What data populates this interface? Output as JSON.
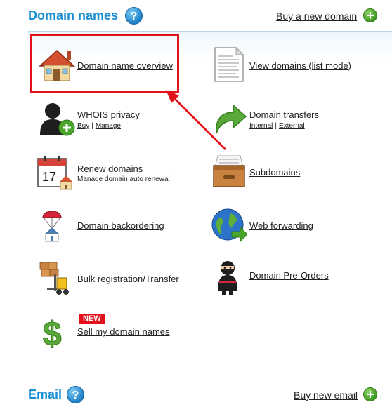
{
  "domains_section": {
    "title": "Domain names",
    "help": "?",
    "buy_link": "Buy a new domain"
  },
  "items": {
    "overview": {
      "label": "Domain name overview"
    },
    "list_mode": {
      "label": "View domains (list mode)"
    },
    "whois": {
      "label": "WHOIS privacy",
      "sub_buy": "Buy",
      "sub_sep": "|",
      "sub_manage": "Manage"
    },
    "transfers": {
      "label": "Domain transfers",
      "sub_internal": "Internal",
      "sub_sep": "|",
      "sub_external": "External"
    },
    "renew": {
      "label": "Renew domains",
      "sub": "Manage domain auto renewal",
      "calendar_day": "17"
    },
    "subdomains": {
      "label": "Subdomains"
    },
    "backorder": {
      "label": "Domain backordering"
    },
    "forwarding": {
      "label": "Web forwarding"
    },
    "bulk": {
      "label": "Bulk registration/Transfer"
    },
    "preorders": {
      "label": "Domain Pre-Orders"
    },
    "sell": {
      "label": "Sell my domain names",
      "badge": "NEW"
    }
  },
  "email_section": {
    "title": "Email",
    "help": "?",
    "buy_link": "Buy new email"
  },
  "colors": {
    "accent": "#1b8fd4",
    "highlight": "#e3111b",
    "plus": "#3f9a22"
  }
}
